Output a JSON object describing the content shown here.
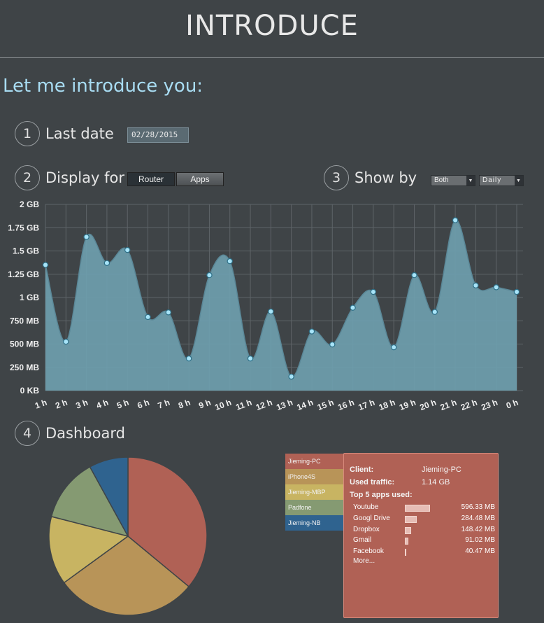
{
  "header": {
    "title": "INTRODUCE"
  },
  "subtitle": "Let me introduce you:",
  "steps": [
    {
      "num": "1",
      "label": "Last date"
    },
    {
      "num": "2",
      "label": "Display for"
    },
    {
      "num": "3",
      "label": "Show by"
    },
    {
      "num": "4",
      "label": "Dashboard"
    }
  ],
  "date_value": "02/28/2015",
  "display_for": {
    "router": "Router",
    "apps": "Apps"
  },
  "show_by": {
    "type": "Both",
    "period": "Daily"
  },
  "colors": {
    "area": "#6e9eae",
    "point": "#a8e4f8",
    "accent": "#a8dcf2"
  },
  "chart_data": {
    "type": "area",
    "categories": [
      "1 h",
      "2 h",
      "3 h",
      "4 h",
      "5 h",
      "6 h",
      "7 h",
      "8 h",
      "9 h",
      "10 h",
      "11 h",
      "12 h",
      "13 h",
      "14 h",
      "15 h",
      "16 h",
      "17 h",
      "18 h",
      "19 h",
      "20 h",
      "21 h",
      "22 h",
      "23 h",
      "0 h"
    ],
    "values_mb": [
      1350,
      525,
      1650,
      1370,
      1510,
      790,
      840,
      345,
      1240,
      1390,
      345,
      850,
      150,
      635,
      495,
      890,
      1060,
      465,
      1240,
      845,
      1830,
      1130,
      1110,
      1060
    ],
    "y_ticks": [
      "0 KB",
      "250 MB",
      "500 MB",
      "750 MB",
      "1 GB",
      "1.25 GB",
      "1.5 GB",
      "1.75 GB",
      "2 GB"
    ],
    "ylim_mb": [
      0,
      2000
    ],
    "grid": true
  },
  "pie_data": {
    "type": "pie",
    "slices": [
      {
        "client": "Jieming-PC",
        "value": 36,
        "color": "#b06155"
      },
      {
        "client": "iPhone4S",
        "value": 29,
        "color": "#b89458"
      },
      {
        "client": "Jieming-MBP",
        "value": 14,
        "color": "#c8b462"
      },
      {
        "client": "Padfone",
        "value": 13,
        "color": "#859a72"
      },
      {
        "client": "Jieming-NB",
        "value": 8,
        "color": "#2f638f"
      }
    ]
  },
  "clients": [
    {
      "name": "Jieming-PC",
      "color": "#b06155"
    },
    {
      "name": "iPhone4S",
      "color": "#b89458"
    },
    {
      "name": "Jieming-MBP",
      "color": "#c8b462"
    },
    {
      "name": "Padfone",
      "color": "#859a72"
    },
    {
      "name": "Jieming-NB",
      "color": "#2f638f"
    }
  ],
  "detail": {
    "client_label": "Client:",
    "client_value": "Jieming-PC",
    "traffic_label": "Used traffic:",
    "traffic_value": "1.14 GB",
    "top_label": "Top 5 apps used:",
    "apps": [
      {
        "name": "Youtube",
        "value": "596.33 MB",
        "mb": 596.33
      },
      {
        "name": "Googl Drive",
        "value": "284.48 MB",
        "mb": 284.48
      },
      {
        "name": "Dropbox",
        "value": "148.42 MB",
        "mb": 148.42
      },
      {
        "name": "Gmail",
        "value": "91.02 MB",
        "mb": 91.02
      },
      {
        "name": "Facebook",
        "value": "40.47 MB",
        "mb": 40.47
      }
    ],
    "more": "More..."
  }
}
